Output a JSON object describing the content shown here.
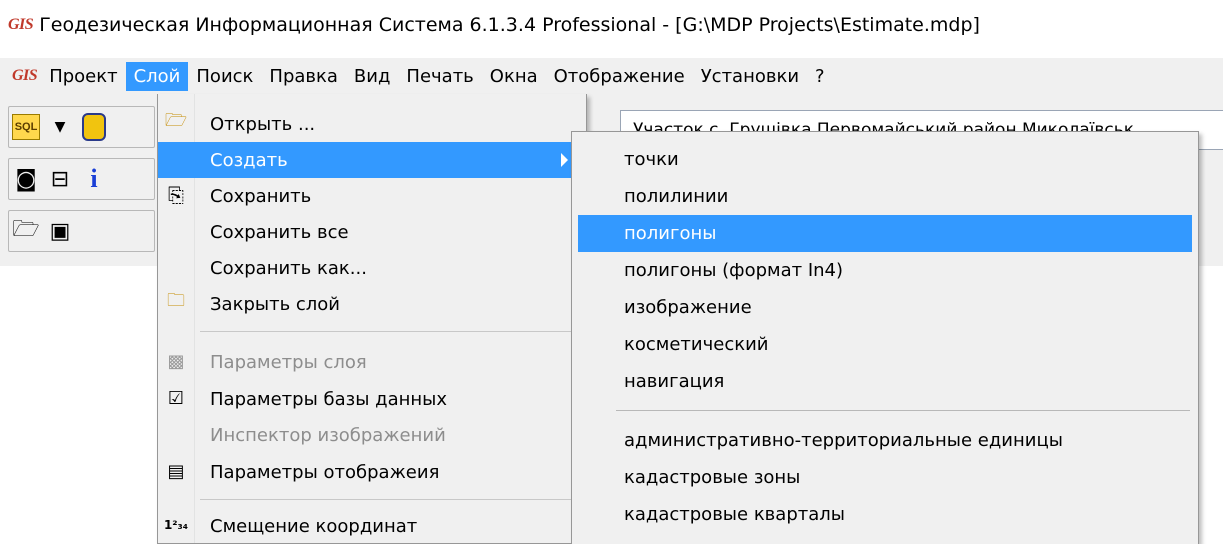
{
  "window": {
    "logo": "GIS",
    "title": "Геодезическая Информационная Система 6.1.3.4 Professional - [G:\\MDP Projects\\Estimate.mdp]"
  },
  "menubar": {
    "logo": "GIS",
    "items": [
      "Проект",
      "Слой",
      "Поиск",
      "Правка",
      "Вид",
      "Печать",
      "Окна",
      "Отображение",
      "Установки",
      "?"
    ],
    "active": "Слой"
  },
  "toolbar": {
    "sql_label": "SQL",
    "info_glyph": "i",
    "current_layer": "Участок  с. Грушівка  Первомайський район  Миколаївськ"
  },
  "layer_menu": {
    "items": [
      {
        "label": "Открыть ...",
        "icon": "open-folder-icon",
        "enabled": true
      },
      {
        "label": "Создать",
        "icon": "",
        "enabled": true,
        "highlighted": true,
        "has_submenu": true
      },
      {
        "label": "Сохранить",
        "icon": "save-icon",
        "enabled": true
      },
      {
        "label": "Сохранить все",
        "icon": "",
        "enabled": true
      },
      {
        "label": "Сохранить как...",
        "icon": "",
        "enabled": true
      },
      {
        "label": "Закрыть слой",
        "icon": "close-folder-icon",
        "enabled": true
      },
      {
        "label": "Параметры слоя",
        "icon": "layer-params-icon",
        "enabled": false
      },
      {
        "label": "Параметры базы данных",
        "icon": "database-icon",
        "enabled": true
      },
      {
        "label": "Инспектор изображений",
        "icon": "",
        "enabled": false
      },
      {
        "label": "Параметры отображеия",
        "icon": "document-icon",
        "enabled": true
      },
      {
        "label": "Смещение координат",
        "icon": "coordinate-shift-icon",
        "enabled": true
      }
    ]
  },
  "create_submenu": {
    "items": [
      {
        "label": "точки"
      },
      {
        "label": "полилинии"
      },
      {
        "label": "полигоны",
        "highlighted": true
      },
      {
        "label": "полигоны (формат In4)"
      },
      {
        "label": "изображение"
      },
      {
        "label": "косметический"
      },
      {
        "label": "навигация"
      },
      {
        "label": "административно-территориальные единицы"
      },
      {
        "label": "кадастровые зоны"
      },
      {
        "label": "кадастровые кварталы"
      }
    ]
  },
  "colors": {
    "highlight": "#3399ff",
    "menu_bg": "#f0f0f0",
    "logo": "#c0392b"
  }
}
